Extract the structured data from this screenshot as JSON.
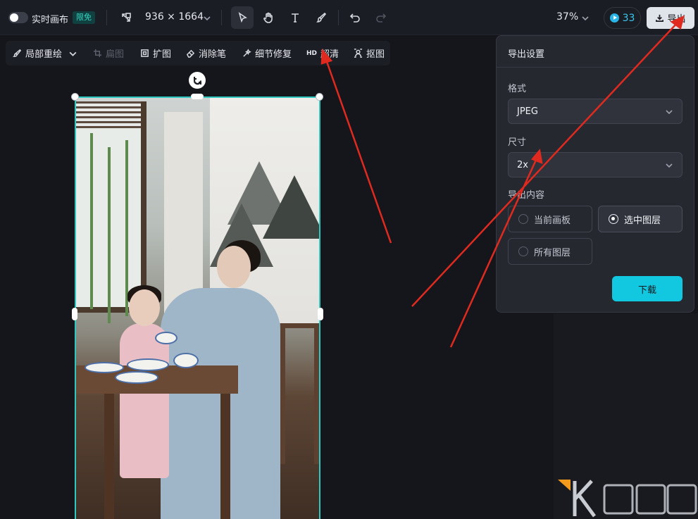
{
  "topbar": {
    "realtime_label": "实时画布",
    "realtime_badge": "限免",
    "canvas_size": "936 × 1664",
    "zoom": "37%",
    "credits": "33",
    "export_label": "导出"
  },
  "toolbar": {
    "items": [
      {
        "label": "局部重绘",
        "icon": "brush-icon",
        "enabled": true
      },
      {
        "label": "扁图",
        "icon": "crop-icon",
        "enabled": false
      },
      {
        "label": "扩图",
        "icon": "expand-icon",
        "enabled": true
      },
      {
        "label": "消除笔",
        "icon": "eraser-icon",
        "enabled": true
      },
      {
        "label": "细节修复",
        "icon": "repair-icon",
        "enabled": true
      },
      {
        "label": "超清",
        "icon": "hd-icon",
        "enabled": true
      },
      {
        "label": "抠图",
        "icon": "cutout-icon",
        "enabled": true
      }
    ],
    "hd_text": "HD"
  },
  "export_panel": {
    "title": "导出设置",
    "format_label": "格式",
    "format_value": "JPEG",
    "size_label": "尺寸",
    "size_value": "2x",
    "content_label": "导出内容",
    "options": [
      {
        "label": "当前画板",
        "selected": false
      },
      {
        "label": "选中图层",
        "selected": true
      },
      {
        "label": "所有图层",
        "selected": false
      }
    ],
    "download_label": "下载"
  },
  "colors": {
    "accent": "#12c7e0",
    "selection": "#2ec8c0",
    "arrow": "#e02a1f",
    "watermark": "#f39a1c"
  }
}
